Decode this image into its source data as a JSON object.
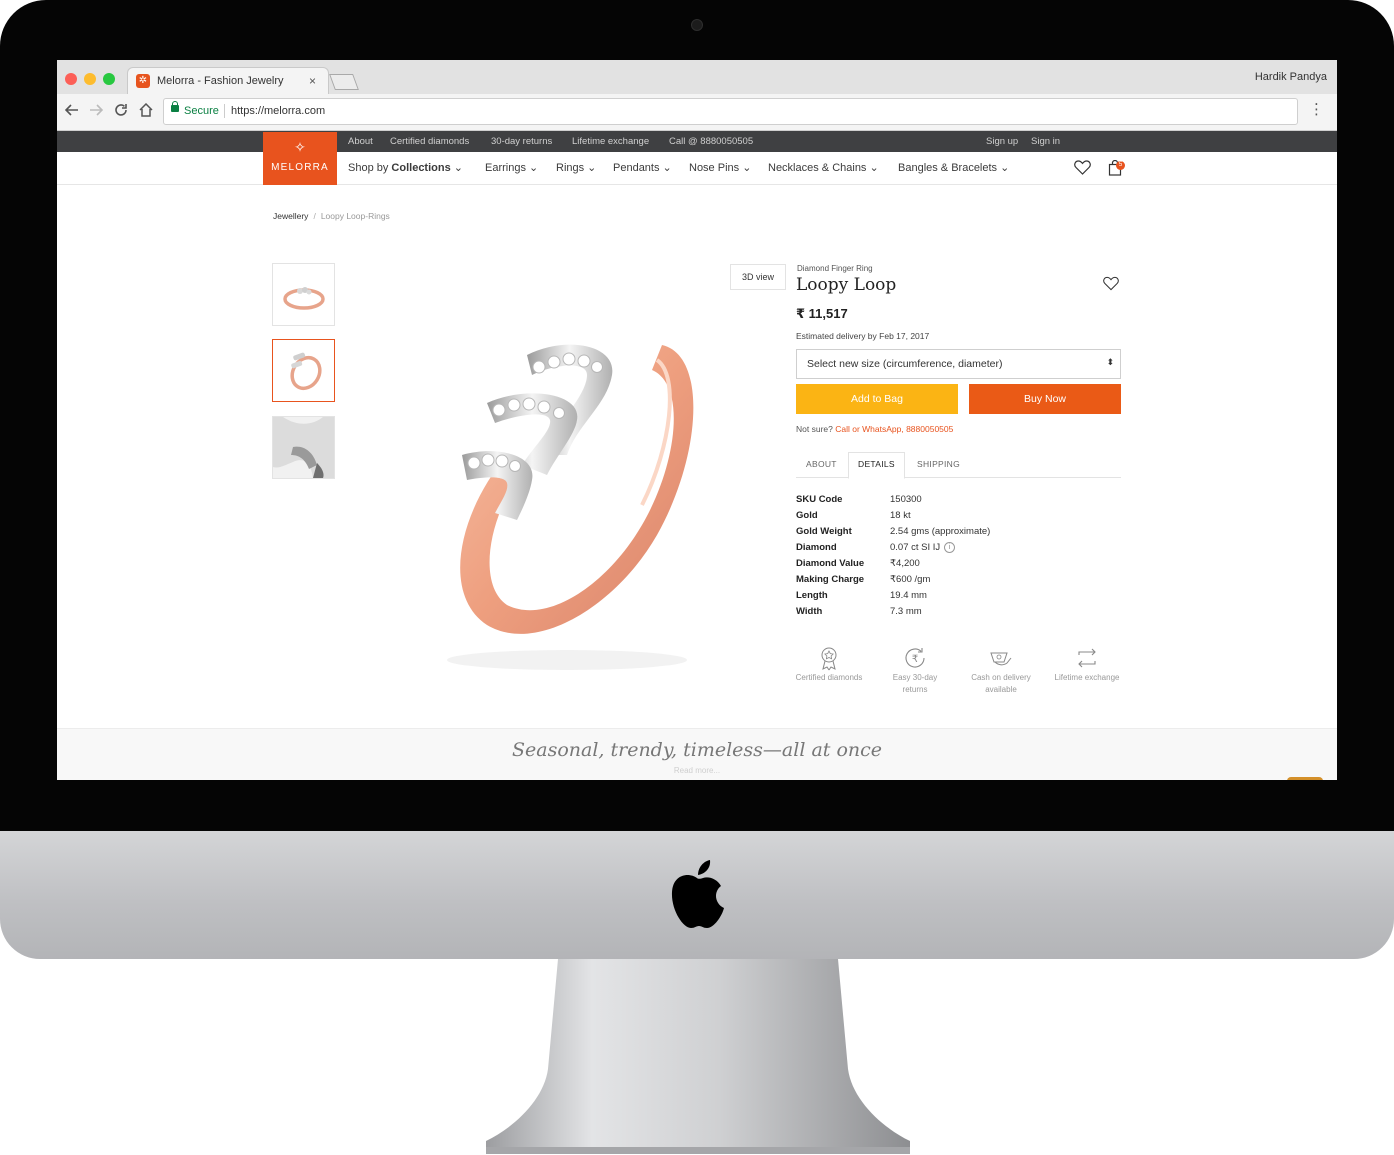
{
  "browser": {
    "tab_title": "Melorra - Fashion Jewelry",
    "tab_close": "×",
    "profile_name": "Hardik Pandya",
    "security_label": "Secure",
    "url": "https://melorra.com",
    "menu_glyph": "⋮",
    "nav_icons": [
      "back-arrow-icon",
      "forward-arrow-icon",
      "reload-icon",
      "home-icon"
    ]
  },
  "site": {
    "brand": "MELORRA",
    "brand_color": "#e8531e",
    "topbar": {
      "links": [
        "About",
        "Certified diamonds",
        "30-day returns",
        "Lifetime exchange",
        "Call @ 8880050505"
      ],
      "sign_up": "Sign up",
      "sign_in": "Sign in"
    },
    "nav": {
      "shop_prefix": "Shop by ",
      "shop_bold": "Collections",
      "caret": "⌄",
      "items": [
        "Earrings",
        "Rings",
        "Pendants",
        "Nose Pins",
        "Necklaces & Chains",
        "Bangles & Bracelets"
      ],
      "bag_count": "5"
    }
  },
  "breadcrumb": {
    "root": "Jewellery",
    "separator": "/",
    "current": "Loopy Loop-Rings"
  },
  "gallery": {
    "view_3d": "3D view",
    "selected_thumb_index": 1
  },
  "product": {
    "category": "Diamond Finger Ring",
    "name": "Loopy Loop",
    "price": "₹ 11,517",
    "delivery": "Estimated delivery by Feb 17, 2017",
    "size_placeholder": "Select new size (circumference, diameter)",
    "add_to_bag": "Add to Bag",
    "buy_now": "Buy Now",
    "add_color": "#fbb414",
    "buy_color": "#ea5a16",
    "help_prefix": "Not sure? ",
    "help_link": "Call or WhatsApp, 8880050505"
  },
  "tabs": {
    "about": "ABOUT",
    "details": "DETAILS",
    "shipping": "SHIPPING",
    "active": "DETAILS"
  },
  "specs": [
    {
      "key": "SKU Code",
      "value": "150300"
    },
    {
      "key": "Gold",
      "value": "18 kt"
    },
    {
      "key": "Gold Weight",
      "value": "2.54 gms (approximate)"
    },
    {
      "key": "Diamond",
      "value": "0.07 ct SI IJ"
    },
    {
      "key": "Diamond Value",
      "value": "₹4,200"
    },
    {
      "key": "Making Charge",
      "value": "₹600 /gm"
    },
    {
      "key": "Length",
      "value": "19.4 mm"
    },
    {
      "key": "Width",
      "value": "7.3 mm"
    }
  ],
  "features": [
    {
      "line1": "Certified diamonds",
      "line2": "",
      "icon": "certified-badge-icon"
    },
    {
      "line1": "Easy 30-day",
      "line2": "returns",
      "icon": "rupee-return-icon"
    },
    {
      "line1": "Cash on delivery",
      "line2": "available",
      "icon": "cash-hand-icon"
    },
    {
      "line1": "Lifetime exchange",
      "line2": "",
      "icon": "exchange-arrows-icon"
    }
  ],
  "footer": {
    "tagline": "Seasonal, trendy, timeless—all at once",
    "read_more": "Read more..."
  }
}
